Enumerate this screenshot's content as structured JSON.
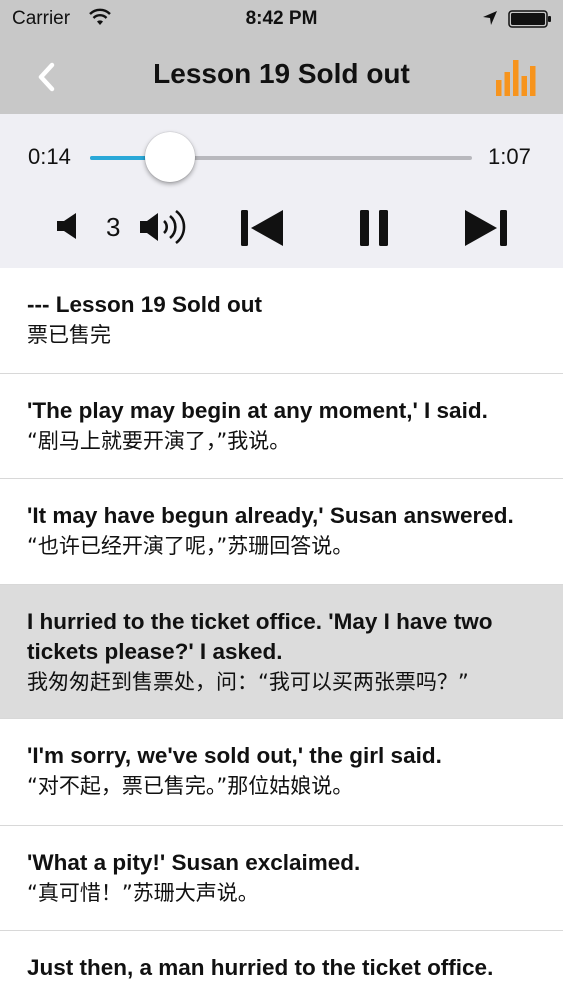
{
  "status_bar": {
    "carrier": "Carrier",
    "time": "8:42 PM",
    "icons": [
      "wifi-icon",
      "location-arrow-icon",
      "battery-icon"
    ]
  },
  "nav": {
    "title": "Lesson 19 Sold out",
    "back_icon": "chevron-left-icon",
    "equalizer_icon": "equalizer-bars-icon",
    "accent_color": "#f7941d"
  },
  "player": {
    "current_time": "0:14",
    "total_time": "1:07",
    "progress": 0.21,
    "volume": "3",
    "accent_color": "#2aa8d8",
    "controls": [
      "volume-down-icon",
      "volume-up-icon",
      "previous-track-icon",
      "pause-icon",
      "next-track-icon"
    ]
  },
  "sentences": [
    {
      "en": "--- Lesson 19  Sold out",
      "zh": "票已售完",
      "selected": false
    },
    {
      "en": "'The play may begin at any moment,' I said.",
      "zh": "“剧马上就要开演了，”我说。",
      "selected": false
    },
    {
      "en": "'It may have begun already,' Susan answered.",
      "zh": "“也许已经开演了呢，”苏珊回答说。",
      "selected": false
    },
    {
      "en": "I hurried to the ticket office. 'May I have two tickets please?' I asked.",
      "zh": "我匆匆赶到售票处，问：“我可以买两张票吗？”",
      "selected": true
    },
    {
      "en": "'I'm sorry, we've sold out,' the girl said.",
      "zh": "“对不起，票已售完。”那位姑娘说。",
      "selected": false
    },
    {
      "en": "'What a pity!' Susan exclaimed.",
      "zh": "“真可惜！”苏珊大声说。",
      "selected": false
    },
    {
      "en": "Just then, a man hurried to the ticket office.",
      "zh": "",
      "selected": false
    }
  ]
}
